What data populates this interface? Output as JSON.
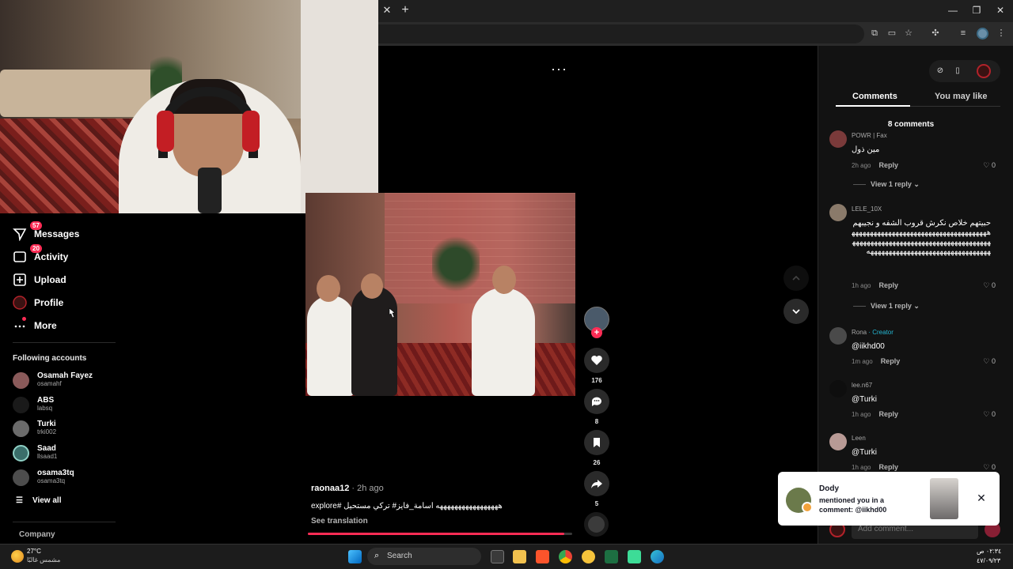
{
  "sidebar": {
    "items": [
      {
        "label": "Messages",
        "badge": "57",
        "icon": "paper-plane-icon"
      },
      {
        "label": "Activity",
        "badge": "20",
        "icon": "inbox-icon"
      },
      {
        "label": "Upload",
        "icon": "plus-square-icon"
      },
      {
        "label": "Profile",
        "icon": "avatar-icon"
      },
      {
        "label": "More",
        "icon": "more-dots-icon"
      }
    ],
    "following_title": "Following accounts",
    "accounts": [
      {
        "name": "Osamah Fayez",
        "handle": "osamahf"
      },
      {
        "name": "ABS",
        "handle": "labsq"
      },
      {
        "name": "Turki",
        "handle": "trki002"
      },
      {
        "name": "Saad",
        "handle": "llsaad1"
      },
      {
        "name": "osama3tq",
        "handle": "osama3tq"
      }
    ],
    "view_all": "View all",
    "company": "Company"
  },
  "video": {
    "author": "raonaa12",
    "time": " · 2h ago",
    "caption": "هههههههههههههههههه اسامة_فايز# تركي مستحيل #explore",
    "see_translation": "See translation",
    "progress": 0.97,
    "likes": "176",
    "comments": "8",
    "saves": "26",
    "shares": "5"
  },
  "panel": {
    "tabs": [
      "Comments",
      "You may like"
    ],
    "count": "8 comments",
    "comments": [
      {
        "user": "POWR | Fax",
        "text": "مين ذول",
        "time": "2h ago",
        "reply": "Reply",
        "likes": "0",
        "view_reply": "View 1 reply"
      },
      {
        "user": "LELE_10X",
        "text": "حبيتهم خلاص نكرش قروب الشفه و نجيبهم هههههههههههههههههههههههههههههههههههههههههههههههههههههههههههههههههههههههههههههههههههههههههههههههههههههههههههههه",
        "time": "1h ago",
        "reply": "Reply",
        "likes": "0",
        "view_reply": "View 1 reply"
      },
      {
        "user": "Rona",
        "creator": " · Creator",
        "text": "@iikhd00",
        "time": "1m ago",
        "reply": "Reply",
        "likes": "0"
      },
      {
        "user": "lee.n67",
        "text": "@Turki",
        "time": "1h ago",
        "reply": "Reply",
        "likes": "0"
      },
      {
        "user": "Leen",
        "text": "@Turki",
        "time": "1h ago",
        "reply": "Reply",
        "likes": "0"
      }
    ],
    "add_comment_placeholder": "Add comment..."
  },
  "notification": {
    "title": "Dody",
    "body": "mentioned you in a comment: @iikhd00"
  },
  "taskbar": {
    "temp": "27°C",
    "condition": "مشمس غالبًا",
    "search": "Search",
    "time": "٠٢:٣٤ ص",
    "date": "٤٧/٠٩/٢٣"
  }
}
